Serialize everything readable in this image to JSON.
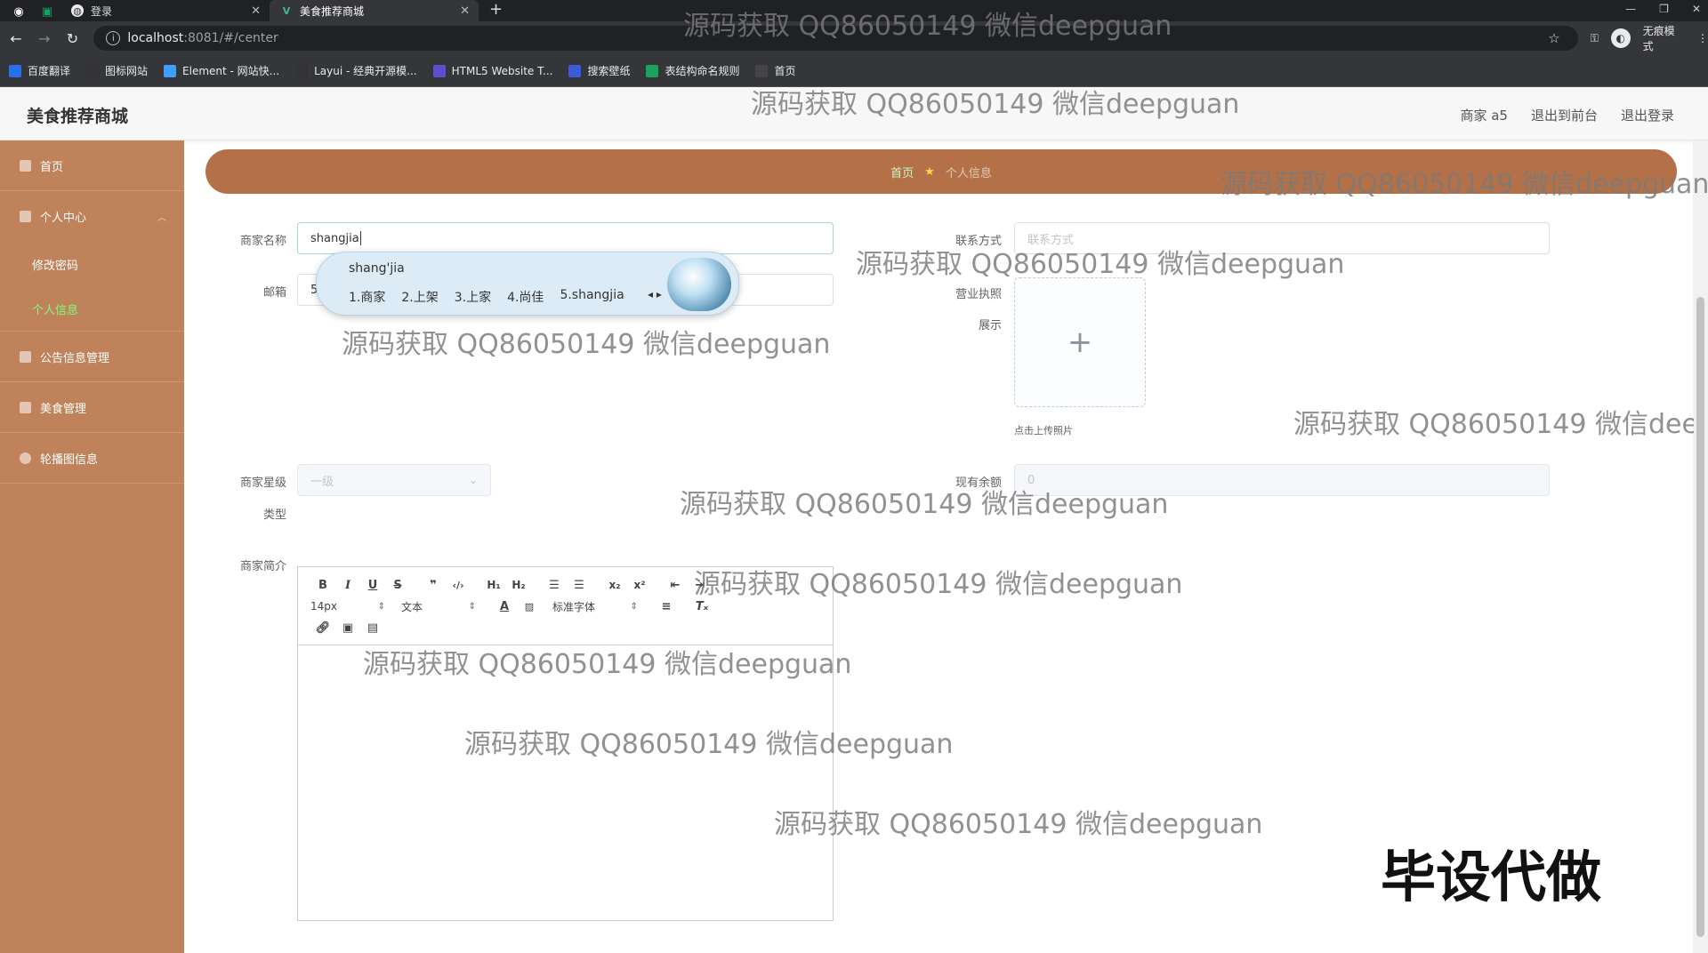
{
  "browser": {
    "tabs": [
      {
        "title": "登录"
      },
      {
        "title": "美食推荐商城"
      }
    ],
    "new_tab": "+",
    "url_host": "localhost",
    "url_rest": ":8081/#/center",
    "incognito_label": "无痕模式",
    "bookmarks": [
      {
        "label": "百度翻译",
        "color": "#2a6ee8"
      },
      {
        "label": "图标网站",
        "color": "#333333"
      },
      {
        "label": "Element - 网站快...",
        "color": "#409eff"
      },
      {
        "label": "Layui - 经典开源模...",
        "color": "#333333"
      },
      {
        "label": "HTML5 Website T...",
        "color": "#5b4fcf"
      },
      {
        "label": "搜索壁纸",
        "color": "#3b5bdb"
      },
      {
        "label": "表结构命名规则",
        "color": "#1aa260"
      },
      {
        "label": "首页",
        "color": "#444444"
      }
    ]
  },
  "header": {
    "title": "美食推荐商城",
    "user": "商家 a5",
    "back_front": "退出到前台",
    "logout": "退出登录"
  },
  "sidebar": {
    "home": "首页",
    "personal_center": "个人中心",
    "change_password": "修改密码",
    "personal_info": "个人信息",
    "notice_mgmt": "公告信息管理",
    "food_mgmt": "美食管理",
    "carousel": "轮播图信息"
  },
  "breadcrumb": {
    "home": "首页",
    "current": "个人信息"
  },
  "form": {
    "merchant_name_label": "商家名称",
    "merchant_name_value": "shangjia",
    "email_label": "邮箱",
    "email_value": "5",
    "contact_label": "联系方式",
    "contact_placeholder": "联系方式",
    "license_label_1": "营业执照",
    "license_label_2": "展示",
    "upload_plus": "+",
    "upload_tip": "点击上传照片",
    "level_label_1": "商家星级",
    "level_label_2": "类型",
    "level_value": "一级",
    "balance_label": "现有余额",
    "balance_value": "0",
    "intro_label": "商家简介"
  },
  "ime": {
    "pinyin": "shang'jia",
    "candidates": [
      "1.商家",
      "2.上架",
      "3.上家",
      "4.尚佳",
      "5.shangjia"
    ]
  },
  "editor": {
    "font_size": "14px",
    "text_type": "文本",
    "font_family": "标准字体"
  },
  "watermark_text": "源码获取 QQ86050149 微信deepguan",
  "corner_text": "毕设代做"
}
